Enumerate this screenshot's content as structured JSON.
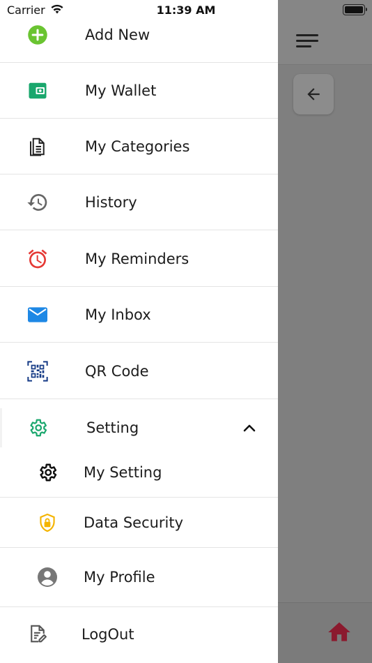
{
  "status_bar": {
    "carrier": "Carrier",
    "time": "11:39 AM"
  },
  "menu": {
    "items": [
      {
        "label": "Add New",
        "icon": "add-circle-icon"
      },
      {
        "label": "My Wallet",
        "icon": "wallet-icon"
      },
      {
        "label": "My Categories",
        "icon": "document-icon"
      },
      {
        "label": "History",
        "icon": "history-icon"
      },
      {
        "label": "My Reminders",
        "icon": "alarm-clock-icon"
      },
      {
        "label": "My Inbox",
        "icon": "mail-icon"
      },
      {
        "label": "QR Code",
        "icon": "qr-code-icon"
      }
    ],
    "setting": {
      "label": "Setting",
      "icon": "gear-icon",
      "expanded": true,
      "children": [
        {
          "label": "My Setting",
          "icon": "gear-icon"
        },
        {
          "label": "Data Security",
          "icon": "shield-lock-icon"
        },
        {
          "label": "My Profile",
          "icon": "account-circle-icon"
        }
      ]
    },
    "logout": {
      "label": "LogOut",
      "icon": "edit-document-icon"
    }
  },
  "colors": {
    "green": "#6ac431",
    "teal": "#1aa76d",
    "red": "#e53935",
    "blue": "#1e88e5",
    "navy": "#163b86",
    "yellow": "#f4b400",
    "home": "#8b1a2e"
  }
}
